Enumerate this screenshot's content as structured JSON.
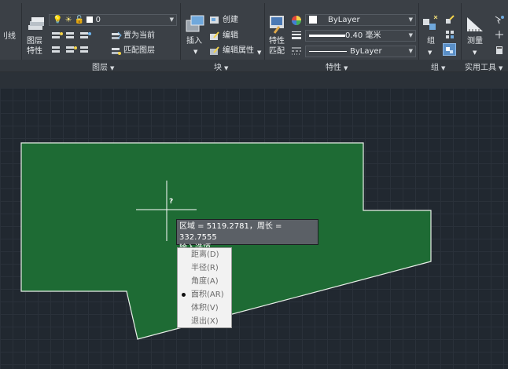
{
  "ribbon": {
    "left_cut_label": "刂线",
    "layers": {
      "layer_props_label_1": "图层",
      "layer_props_label_2": "特性",
      "current_layer": "0",
      "set_current": "置为当前",
      "match_layer": "匹配图层",
      "title": "图层"
    },
    "block": {
      "insert_label": "插入",
      "create": "创建",
      "edit": "编辑",
      "edit_attributes": "编辑属性",
      "title": "块"
    },
    "properties": {
      "match_label_1": "特性",
      "match_label_2": "匹配",
      "color": "ByLayer",
      "lineweight": "0.40 毫米",
      "linetype": "ByLayer",
      "title": "特性"
    },
    "groups": {
      "group_label": "组",
      "title": "组"
    },
    "utilities": {
      "measure_label": "测量",
      "title": "实用工具"
    }
  },
  "tooltip": {
    "line1": "区域 = 5119.2781，周长 = 332.7555",
    "line2": "输入选项"
  },
  "crosshair_label": "?",
  "options_menu": [
    {
      "label": "距离(D)",
      "selected": false
    },
    {
      "label": "半径(R)",
      "selected": false
    },
    {
      "label": "角度(A)",
      "selected": false
    },
    {
      "label": "面积(AR)",
      "selected": true
    },
    {
      "label": "体积(V)",
      "selected": false
    },
    {
      "label": "退出(X)",
      "selected": false
    }
  ],
  "colors": {
    "region_fill": "#1e6b34",
    "region_outline": "#e8efe8",
    "canvas": "#212830"
  }
}
